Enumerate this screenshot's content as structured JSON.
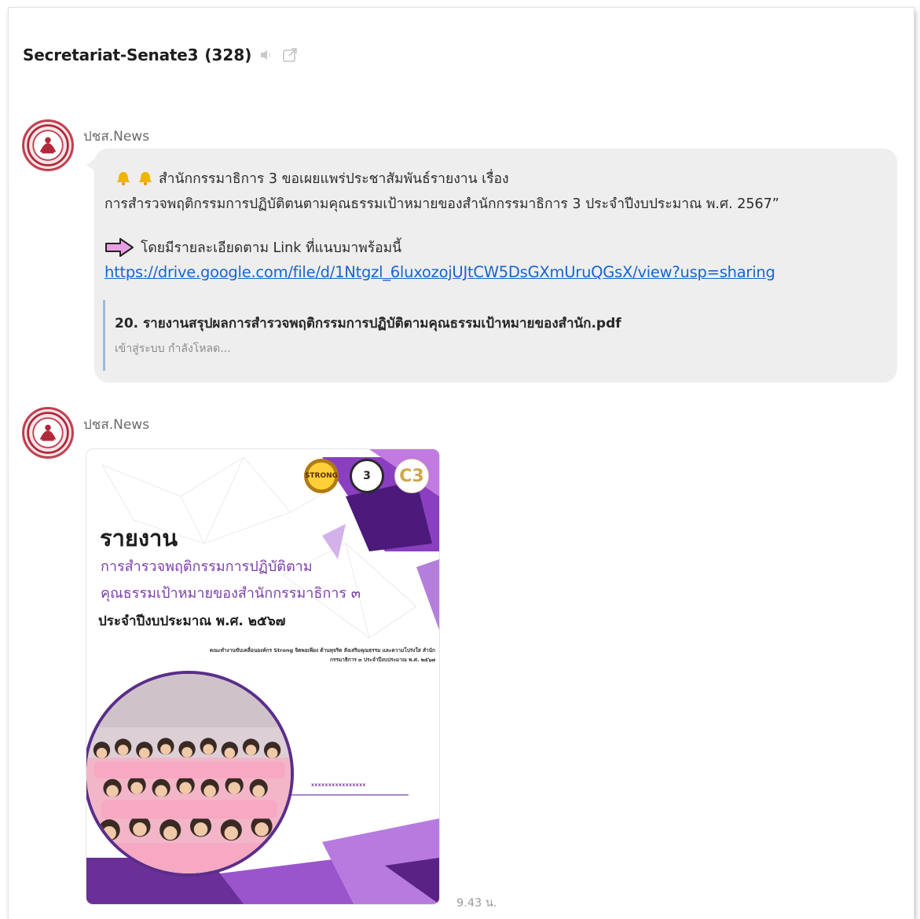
{
  "header": {
    "title": "Secretariat-Senate3",
    "count": "(328)",
    "icons": [
      "speaker-muted-icon",
      "external-link-icon"
    ]
  },
  "messages": [
    {
      "sender": "ปชส.News",
      "avatar": "senate-emblem",
      "line1": "สำนักกรรมาธิการ 3 ขอเผยแพร่ประชาสัมพันธ์รายงาน เรื่อง",
      "line2": "การสำรวจพฤติกรรมการปฏิบัติตนตามคุณธรรมเป้าหมายของสำนักกรรมาธิการ 3 ประจำปีงบประมาณ พ.ศ. 2567”",
      "line3": "โดยมีรายละเอียดตาม Link ที่แนบมาพร้อมนี้",
      "link": "https://drive.google.com/file/d/1Ntgzl_6luxozojUJtCW5DsGXmUruQGsX/view?usp=sharing",
      "preview": {
        "title": "20. รายงานสรุปผลการสำรวจพฤติกรรมการปฏิบัติตามคุณธรรมเป้าหมายของสำนัก.pdf",
        "subtitle": "เข้าสู่ระบบ กำลังโหลด..."
      }
    },
    {
      "sender": "ปชส.News",
      "avatar": "senate-emblem",
      "image": {
        "title": "รายงาน",
        "subtitle1": "การสำรวจพฤติกรรมการปฏิบัติตาม",
        "subtitle2": "คุณธรรมเป้าหมายของสำนักกรรมาธิการ ๓",
        "subtitle3": "ประจำปีงบประมาณ พ.ศ. ๒๕๖๗",
        "small_text": "คณะทำงานขับเคลื่อนองค์กร Strong จิตพอเพียง ต้านทุจริต สังเสริมคุณธรรม และความโปร่งใส สำนักกรรมาธิการ ๓ ประจำปีงบประมาณ พ.ศ. ๒๕๖๗",
        "footer": "xxxxxxxxxxxxxxxx",
        "badges": [
          "STRONG",
          "3",
          "C3"
        ]
      },
      "time": "9.43 น."
    }
  ],
  "colors": {
    "link": "#1a65c9",
    "bubble": "#eeeeee",
    "poster_purple": "#7c3fa8",
    "preview_bar": "#9db9dd"
  }
}
